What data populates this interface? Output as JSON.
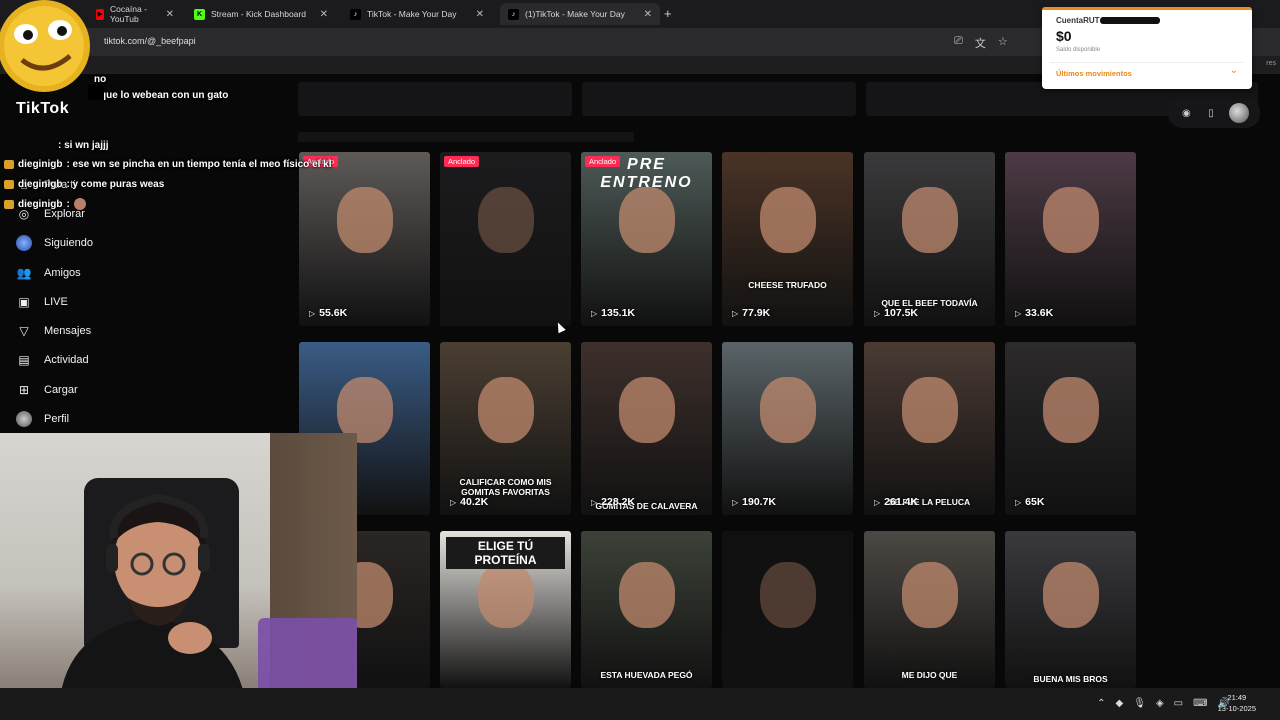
{
  "browser": {
    "tabs": [
      {
        "title": "Cocaína - YouTub",
        "fav_color": "#ff0000",
        "fav_glyph": "▶",
        "active": false
      },
      {
        "title": "Stream - Kick Dashboard",
        "fav_color": "#53fc18",
        "fav_glyph": "K",
        "active": false
      },
      {
        "title": "TikTok - Make Your Day",
        "fav_color": "#000000",
        "fav_glyph": "♪",
        "active": false
      },
      {
        "title": "(1)TikTok - Make Your Day",
        "fav_color": "#000000",
        "fav_glyph": "♪",
        "active": true
      }
    ],
    "new_tab": "+",
    "url": "tiktok.com/@_beefpapi",
    "bookmarks_right": "res"
  },
  "chat": {
    "lines": [
      {
        "user": "",
        "text": "no"
      },
      {
        "user": "",
        "text": "que lo webean con un gato"
      },
      {
        "user": "",
        "text": ": si wn jajjj"
      },
      {
        "user": "dieginigb",
        "text": ": ese wn se pincha en un tiempo tenía el meo físico el kl"
      },
      {
        "user": "dieginigb",
        "text": ": y come puras weas"
      },
      {
        "user": "dieginigb",
        "text": ":"
      }
    ]
  },
  "sidebar": {
    "logo": "TikTok",
    "items": [
      {
        "label": "Para ti",
        "icon": "home-icon",
        "glyph": "⌂"
      },
      {
        "label": "Explorar",
        "icon": "compass-icon",
        "glyph": "◎"
      },
      {
        "label": "Siguiendo",
        "icon": "following-avatar-icon",
        "glyph": ""
      },
      {
        "label": "Amigos",
        "icon": "friends-icon",
        "glyph": "👥"
      },
      {
        "label": "LIVE",
        "icon": "live-icon",
        "glyph": "▣"
      },
      {
        "label": "Mensajes",
        "icon": "messages-icon",
        "glyph": "▽"
      },
      {
        "label": "Actividad",
        "icon": "activity-icon",
        "glyph": "▤",
        "badge": "1"
      },
      {
        "label": "Cargar",
        "icon": "upload-icon",
        "glyph": "⊞"
      },
      {
        "label": "Perfil",
        "icon": "profile-avatar-icon",
        "glyph": ""
      }
    ]
  },
  "videos": [
    {
      "views": "55.6K",
      "pinned": true,
      "caption": "",
      "color": "#5d5a58"
    },
    {
      "views": "",
      "pinned": true,
      "caption": "",
      "color": "#1c1c1e"
    },
    {
      "views": "135.1K",
      "pinned": true,
      "caption": "PRE ENTRENO",
      "color": "#4d5a57"
    },
    {
      "views": "77.9K",
      "pinned": false,
      "caption": "CHEESE TRUFADO",
      "color": "#4a3326"
    },
    {
      "views": "107.5K",
      "pinned": false,
      "caption": "QUE EL BEEF TODAVÍA",
      "color": "#3a3a3c"
    },
    {
      "views": "33.6K",
      "pinned": false,
      "caption": "",
      "color": "#4d3a46"
    },
    {
      "views": "",
      "pinned": false,
      "caption": "",
      "color": "#3a5c86"
    },
    {
      "views": "40.2K",
      "pinned": false,
      "caption": "CALIFICAR COMO MIS GOMITAS FAVORITAS",
      "color": "#4b3f33"
    },
    {
      "views": "228.2K",
      "pinned": false,
      "caption": "GOMITAS DE CALAVERA",
      "color": "#3e302c"
    },
    {
      "views": "190.7K",
      "pinned": false,
      "caption": "",
      "color": "#5a6468"
    },
    {
      "views": "261.4K",
      "pinned": false,
      "caption": "SE FUE LA PELUCA",
      "color": "#4a3a34"
    },
    {
      "views": "65K",
      "pinned": false,
      "caption": "",
      "color": "#2c2a2a"
    },
    {
      "views": "",
      "pinned": false,
      "caption": "",
      "color": "#2a2624"
    },
    {
      "views": "",
      "pinned": false,
      "caption": "ELIGE TÚ PROTEÍNA",
      "color": "#e5e2de"
    },
    {
      "views": "",
      "pinned": false,
      "caption": "ESTA HUEVADA PEGÓ",
      "color": "#3c4238"
    },
    {
      "views": "",
      "pinned": false,
      "caption": "",
      "color": "#101010"
    },
    {
      "views": "",
      "pinned": false,
      "caption": "ME DIJO QUE",
      "color": "#4c4844"
    },
    {
      "views": "",
      "pinned": false,
      "caption": "BUENA MIS BROS",
      "color": "#3a3a3e"
    }
  ],
  "pinned_label": "Anclado",
  "bank": {
    "title": "CuentaRUT",
    "amount": "$0",
    "subtitle": "Saldo disponible",
    "link": "Últimos movimientos",
    "accent": "#f08a1c"
  },
  "taskbar": {
    "time": "21:49",
    "date": "13-10-2025"
  }
}
